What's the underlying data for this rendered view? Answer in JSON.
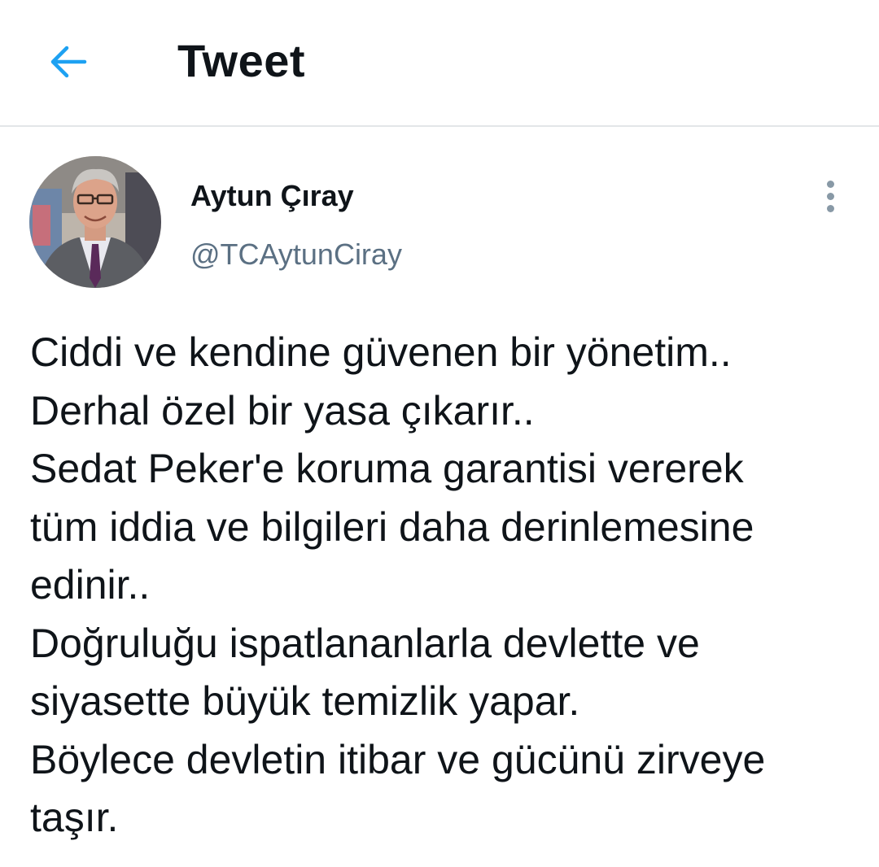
{
  "header": {
    "title": "Tweet",
    "back_icon": "arrow-left-icon",
    "accent_color": "#1da1f2"
  },
  "tweet": {
    "author": {
      "display_name": "Aytun Çıray",
      "handle": "@TCAytunCiray"
    },
    "more_icon": "more-vertical-icon",
    "lines": [
      "Ciddi ve kendine güvenen bir yönetim..",
      "Derhal özel bir yasa çıkarır..",
      "Sedat Peker'e koruma garantisi vererek",
      "tüm iddia ve bilgileri daha derinlemesine",
      "edinir..",
      "Doğruluğu ispatlananlarla devlette ve",
      "siyasette büyük temizlik yapar.",
      "Böylece devletin itibar ve gücünü zirveye",
      "taşır."
    ]
  },
  "colors": {
    "text": "#0f1419",
    "secondary_text": "#5b7083",
    "divider": "#e3e6e8"
  }
}
